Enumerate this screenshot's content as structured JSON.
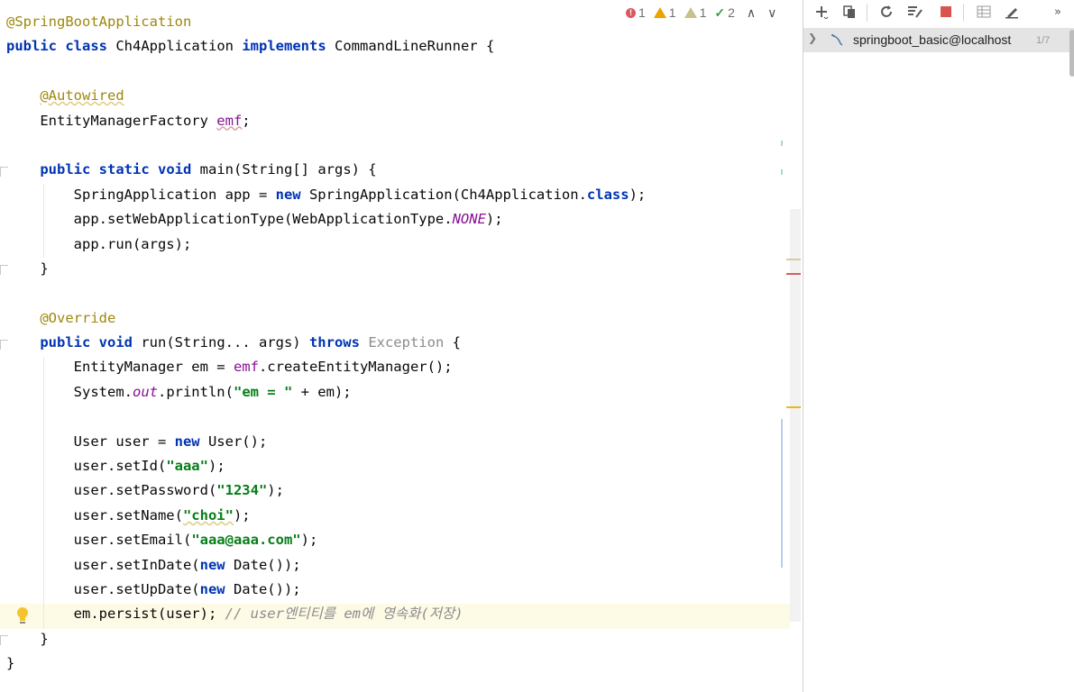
{
  "editor": {
    "lines": [
      [
        {
          "t": "@SpringBootApplication",
          "c": "ann"
        }
      ],
      [
        {
          "t": "public",
          "c": "kw"
        },
        {
          "t": " "
        },
        {
          "t": "class",
          "c": "kw"
        },
        {
          "t": " Ch4Application "
        },
        {
          "t": "implements",
          "c": "kw"
        },
        {
          "t": " CommandLineRunner {"
        }
      ],
      [],
      [
        {
          "t": "    "
        },
        {
          "t": "@Autowired",
          "c": "ann squig-y"
        }
      ],
      [
        {
          "t": "    EntityManagerFactory "
        },
        {
          "t": "emf",
          "c": "field squig"
        },
        {
          "t": ";"
        }
      ],
      [],
      [
        {
          "t": "    "
        },
        {
          "t": "public",
          "c": "kw"
        },
        {
          "t": " "
        },
        {
          "t": "static",
          "c": "kw"
        },
        {
          "t": " "
        },
        {
          "t": "void",
          "c": "kw"
        },
        {
          "t": " main(String[] args) {"
        }
      ],
      [
        {
          "t": "        SpringApplication app = "
        },
        {
          "t": "new",
          "c": "kw"
        },
        {
          "t": " SpringApplication(Ch4Application."
        },
        {
          "t": "class",
          "c": "kw"
        },
        {
          "t": ");"
        }
      ],
      [
        {
          "t": "        app.setWebApplicationType(WebApplicationType."
        },
        {
          "t": "NONE",
          "c": "static"
        },
        {
          "t": ");"
        }
      ],
      [
        {
          "t": "        app.run(args);"
        }
      ],
      [
        {
          "t": "    }"
        }
      ],
      [],
      [
        {
          "t": "    "
        },
        {
          "t": "@Override",
          "c": "ann"
        }
      ],
      [
        {
          "t": "    "
        },
        {
          "t": "public",
          "c": "kw"
        },
        {
          "t": " "
        },
        {
          "t": "void",
          "c": "kw"
        },
        {
          "t": " run(String... args) "
        },
        {
          "t": "throws",
          "c": "kw"
        },
        {
          "t": " "
        },
        {
          "t": "Exception",
          "c": "gray"
        },
        {
          "t": " {"
        }
      ],
      [
        {
          "t": "        EntityManager em = "
        },
        {
          "t": "emf",
          "c": "field"
        },
        {
          "t": ".createEntityManager();"
        }
      ],
      [
        {
          "t": "        System."
        },
        {
          "t": "out",
          "c": "static"
        },
        {
          "t": ".println("
        },
        {
          "t": "\"em = \"",
          "c": "str"
        },
        {
          "t": " + em);"
        }
      ],
      [],
      [
        {
          "t": "        User user = "
        },
        {
          "t": "new",
          "c": "kw"
        },
        {
          "t": " User();"
        }
      ],
      [
        {
          "t": "        user.setId("
        },
        {
          "t": "\"aaa\"",
          "c": "str"
        },
        {
          "t": ");"
        }
      ],
      [
        {
          "t": "        user.setPassword("
        },
        {
          "t": "\"1234\"",
          "c": "str"
        },
        {
          "t": ");"
        }
      ],
      [
        {
          "t": "        user.setName("
        },
        {
          "t": "\"choi\"",
          "c": "str squig-y"
        },
        {
          "t": ");"
        }
      ],
      [
        {
          "t": "        user.setEmail("
        },
        {
          "t": "\"aaa@aaa.com\"",
          "c": "str"
        },
        {
          "t": ");"
        }
      ],
      [
        {
          "t": "        user.setInDate("
        },
        {
          "t": "new",
          "c": "kw"
        },
        {
          "t": " Date());"
        }
      ],
      [
        {
          "t": "        user.setUpDate("
        },
        {
          "t": "new",
          "c": "kw"
        },
        {
          "t": " Date());"
        }
      ],
      [
        {
          "t": "        em.persist(user); "
        },
        {
          "t": "// user엔티티를 em에 영속화(저장)",
          "c": "comment"
        }
      ],
      [
        {
          "t": "    }"
        }
      ],
      [
        {
          "t": "}"
        }
      ]
    ]
  },
  "inspections": {
    "errors": "1",
    "warnings": "1",
    "weak_warnings": "1",
    "typos": "2",
    "up_arrow": "∧",
    "down_arrow": "∨"
  },
  "database_panel": {
    "toolbar_icons": [
      "add-icon",
      "copy-icon",
      "refresh-icon",
      "schema-icon",
      "stop-icon",
      "table-icon",
      "edit-icon",
      "more-icon"
    ],
    "tree": {
      "label": "springboot_basic@localhost",
      "count": "1/7"
    }
  },
  "colors": {
    "keyword": "#0033b3",
    "annotation": "#9e880d",
    "string": "#067d17",
    "field": "#871094",
    "comment": "#8c8c8c",
    "current_line": "#fdfae6"
  }
}
